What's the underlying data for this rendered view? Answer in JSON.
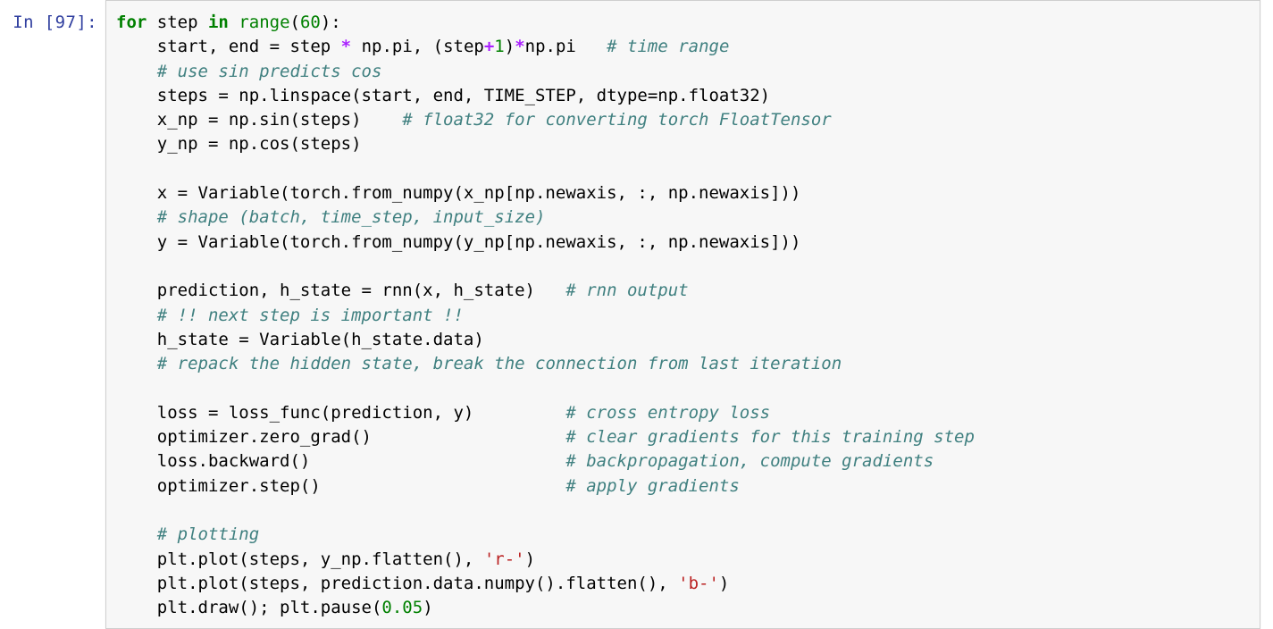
{
  "cell": {
    "prompt_label": "In [97]:",
    "execution_count": 97,
    "cell_type": "code",
    "language": "python",
    "colors": {
      "prompt": "#303F9F",
      "cell_background": "#f7f7f7",
      "cell_border": "#cfcfcf",
      "page_background": "#ffffff",
      "text": "#000000",
      "keyword": "#008000",
      "number": "#008000",
      "builtin": "#008000",
      "operator": "#AA22FF",
      "comment": "#408080",
      "string": "#BA2121"
    },
    "source_text": "for step in range(60):\n    start, end = step * np.pi, (step+1)*np.pi   # time range\n    # use sin predicts cos\n    steps = np.linspace(start, end, TIME_STEP, dtype=np.float32)\n    x_np = np.sin(steps)    # float32 for converting torch FloatTensor\n    y_np = np.cos(steps)\n\n    x = Variable(torch.from_numpy(x_np[np.newaxis, :, np.newaxis]))\n    # shape (batch, time_step, input_size)\n    y = Variable(torch.from_numpy(y_np[np.newaxis, :, np.newaxis]))\n\n    prediction, h_state = rnn(x, h_state)   # rnn output\n    # !! next step is important !!\n    h_state = Variable(h_state.data)\n    # repack the hidden state, break the connection from last iteration\n\n    loss = loss_func(prediction, y)         # cross entropy loss\n    optimizer.zero_grad()                   # clear gradients for this training step\n    loss.backward()                         # backpropagation, compute gradients\n    optimizer.step()                        # apply gradients\n\n    # plotting\n    plt.plot(steps, y_np.flatten(), 'r-')\n    plt.plot(steps, prediction.data.numpy().flatten(), 'b-')\n    plt.draw(); plt.pause(0.05)",
    "lines": [
      {
        "n": 1,
        "tokens": [
          {
            "t": "for",
            "c": "k"
          },
          {
            "t": " step ",
            "c": "n"
          },
          {
            "t": "in",
            "c": "k"
          },
          {
            "t": " ",
            "c": "n"
          },
          {
            "t": "range",
            "c": "nb"
          },
          {
            "t": "(",
            "c": "n"
          },
          {
            "t": "60",
            "c": "mi"
          },
          {
            "t": "):",
            "c": "n"
          }
        ]
      },
      {
        "n": 2,
        "tokens": [
          {
            "t": "    start, end = step ",
            "c": "n"
          },
          {
            "t": "*",
            "c": "o"
          },
          {
            "t": " np.pi, (step",
            "c": "n"
          },
          {
            "t": "+",
            "c": "o"
          },
          {
            "t": "1",
            "c": "mi"
          },
          {
            "t": ")",
            "c": "n"
          },
          {
            "t": "*",
            "c": "o"
          },
          {
            "t": "np.pi   ",
            "c": "n"
          },
          {
            "t": "# time range",
            "c": "c"
          }
        ]
      },
      {
        "n": 3,
        "tokens": [
          {
            "t": "    ",
            "c": "n"
          },
          {
            "t": "# use sin predicts cos",
            "c": "c"
          }
        ]
      },
      {
        "n": 4,
        "tokens": [
          {
            "t": "    steps = np.linspace(start, end, TIME_STEP, dtype=np.float32)",
            "c": "n"
          }
        ]
      },
      {
        "n": 5,
        "tokens": [
          {
            "t": "    x_np = np.sin(steps)    ",
            "c": "n"
          },
          {
            "t": "# float32 for converting torch FloatTensor",
            "c": "c"
          }
        ]
      },
      {
        "n": 6,
        "tokens": [
          {
            "t": "    y_np = np.cos(steps)",
            "c": "n"
          }
        ]
      },
      {
        "n": 7,
        "tokens": [
          {
            "t": "",
            "c": "n"
          }
        ]
      },
      {
        "n": 8,
        "tokens": [
          {
            "t": "    x = Variable(torch.from_numpy(x_np[np.newaxis, :, np.newaxis]))",
            "c": "n"
          }
        ]
      },
      {
        "n": 9,
        "tokens": [
          {
            "t": "    ",
            "c": "n"
          },
          {
            "t": "# shape (batch, time_step, input_size)",
            "c": "c"
          }
        ]
      },
      {
        "n": 10,
        "tokens": [
          {
            "t": "    y = Variable(torch.from_numpy(y_np[np.newaxis, :, np.newaxis]))",
            "c": "n"
          }
        ]
      },
      {
        "n": 11,
        "tokens": [
          {
            "t": "",
            "c": "n"
          }
        ]
      },
      {
        "n": 12,
        "tokens": [
          {
            "t": "    prediction, h_state = rnn(x, h_state)   ",
            "c": "n"
          },
          {
            "t": "# rnn output",
            "c": "c"
          }
        ]
      },
      {
        "n": 13,
        "tokens": [
          {
            "t": "    ",
            "c": "n"
          },
          {
            "t": "# !! next step is important !!",
            "c": "c"
          }
        ]
      },
      {
        "n": 14,
        "tokens": [
          {
            "t": "    h_state = Variable(h_state.data)",
            "c": "n"
          }
        ]
      },
      {
        "n": 15,
        "tokens": [
          {
            "t": "    ",
            "c": "n"
          },
          {
            "t": "# repack the hidden state, break the connection from last iteration",
            "c": "c"
          }
        ]
      },
      {
        "n": 16,
        "tokens": [
          {
            "t": "",
            "c": "n"
          }
        ]
      },
      {
        "n": 17,
        "tokens": [
          {
            "t": "    loss = loss_func(prediction, y)         ",
            "c": "n"
          },
          {
            "t": "# cross entropy loss",
            "c": "c"
          }
        ]
      },
      {
        "n": 18,
        "tokens": [
          {
            "t": "    optimizer.zero_grad()                   ",
            "c": "n"
          },
          {
            "t": "# clear gradients for this training step",
            "c": "c"
          }
        ]
      },
      {
        "n": 19,
        "tokens": [
          {
            "t": "    loss.backward()                         ",
            "c": "n"
          },
          {
            "t": "# backpropagation, compute gradients",
            "c": "c"
          }
        ]
      },
      {
        "n": 20,
        "tokens": [
          {
            "t": "    optimizer.step()                        ",
            "c": "n"
          },
          {
            "t": "# apply gradients",
            "c": "c"
          }
        ]
      },
      {
        "n": 21,
        "tokens": [
          {
            "t": "",
            "c": "n"
          }
        ]
      },
      {
        "n": 22,
        "tokens": [
          {
            "t": "    ",
            "c": "n"
          },
          {
            "t": "# plotting",
            "c": "c"
          }
        ]
      },
      {
        "n": 23,
        "tokens": [
          {
            "t": "    plt.plot(steps, y_np.flatten(), ",
            "c": "n"
          },
          {
            "t": "'r-'",
            "c": "s"
          },
          {
            "t": ")",
            "c": "n"
          }
        ]
      },
      {
        "n": 24,
        "tokens": [
          {
            "t": "    plt.plot(steps, prediction.data.numpy().flatten(), ",
            "c": "n"
          },
          {
            "t": "'b-'",
            "c": "s"
          },
          {
            "t": ")",
            "c": "n"
          }
        ]
      },
      {
        "n": 25,
        "tokens": [
          {
            "t": "    plt.draw(); plt.pause(",
            "c": "n"
          },
          {
            "t": "0.05",
            "c": "mi"
          },
          {
            "t": ")",
            "c": "n"
          }
        ]
      }
    ]
  }
}
